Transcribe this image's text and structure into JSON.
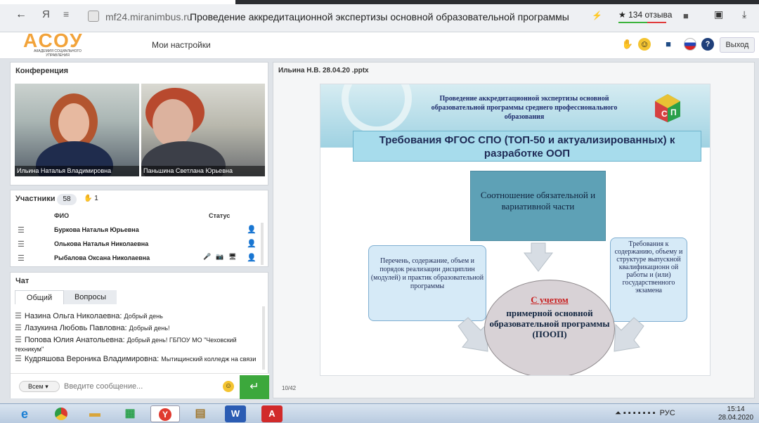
{
  "browser": {
    "site": "mf24.miranimbus.ru",
    "title": "Проведение аккредитационной экспертизы основной образовательной программы ср...",
    "rating": "★ 134 отзыва",
    "yandex": "Я"
  },
  "header": {
    "logo": "АСОУ",
    "logo_sub": "АКАДЕМИЯ СОЦИАЛЬНОГО УПРАВЛЕНИЯ",
    "settings": "Мои настройки",
    "exit": "Выход"
  },
  "conference": {
    "title": "Конференция",
    "videos": [
      {
        "name": "Ильина Наталья Владимировна"
      },
      {
        "name": "Паньшина Светлана Юрьевна"
      }
    ]
  },
  "participants": {
    "title": "Участники",
    "count": "58",
    "raised_hands": "1",
    "col_name": "ФИО",
    "col_status": "Статус",
    "rows": [
      {
        "name": "Буркова Наталья Юрьевна"
      },
      {
        "name": "Олькова Наталья Николаевна"
      },
      {
        "name": "Рыбалова  Оксана  Николаевна"
      }
    ]
  },
  "chat": {
    "title": "Чат",
    "tabs": [
      "Общий",
      "Вопросы"
    ],
    "messages": [
      {
        "author": "Назина Ольга Николаевна:",
        "text": "Добрый день"
      },
      {
        "author": "Лазукина Любовь Павловна:",
        "text": "Добрый день!"
      },
      {
        "author": "Попова Юлия Анатольевна:",
        "text": "Добрый день! ГБПОУ МО \"Чеховский техникум\""
      },
      {
        "author": "Кудряшова Вероника Владимировна:",
        "text": "Мытищинский колледж на связи"
      }
    ],
    "recipient": "Всем",
    "input_placeholder": "Введите сообщение..."
  },
  "presentation": {
    "file": "Ильина Н.В. 28.04.20 .pptx",
    "page": "10/42",
    "slide": {
      "header": "Проведение аккредитационной экспертизы основной образовательной программы среднего профессионального образования",
      "banner": "Требования ФГОС СПО (ТОП-50 и актуализированных) к разработке ООП",
      "box_top": "Соотношение обязательной и вариативной части",
      "box_left": "Перечень, содержание, объем и порядок реализации дисциплин (модулей) и практик образовательной программы",
      "box_right": "Требования к содержанию, объему и структуре выпускной квалификационн ой работы и (или) государственного экзамена",
      "ellipse_highlight": "С учетом",
      "ellipse_text": "примерной основной образовательной программы (ПООП)"
    }
  },
  "taskbar": {
    "lang": "РУС",
    "time": "15:14",
    "date": "28.04.2020"
  }
}
